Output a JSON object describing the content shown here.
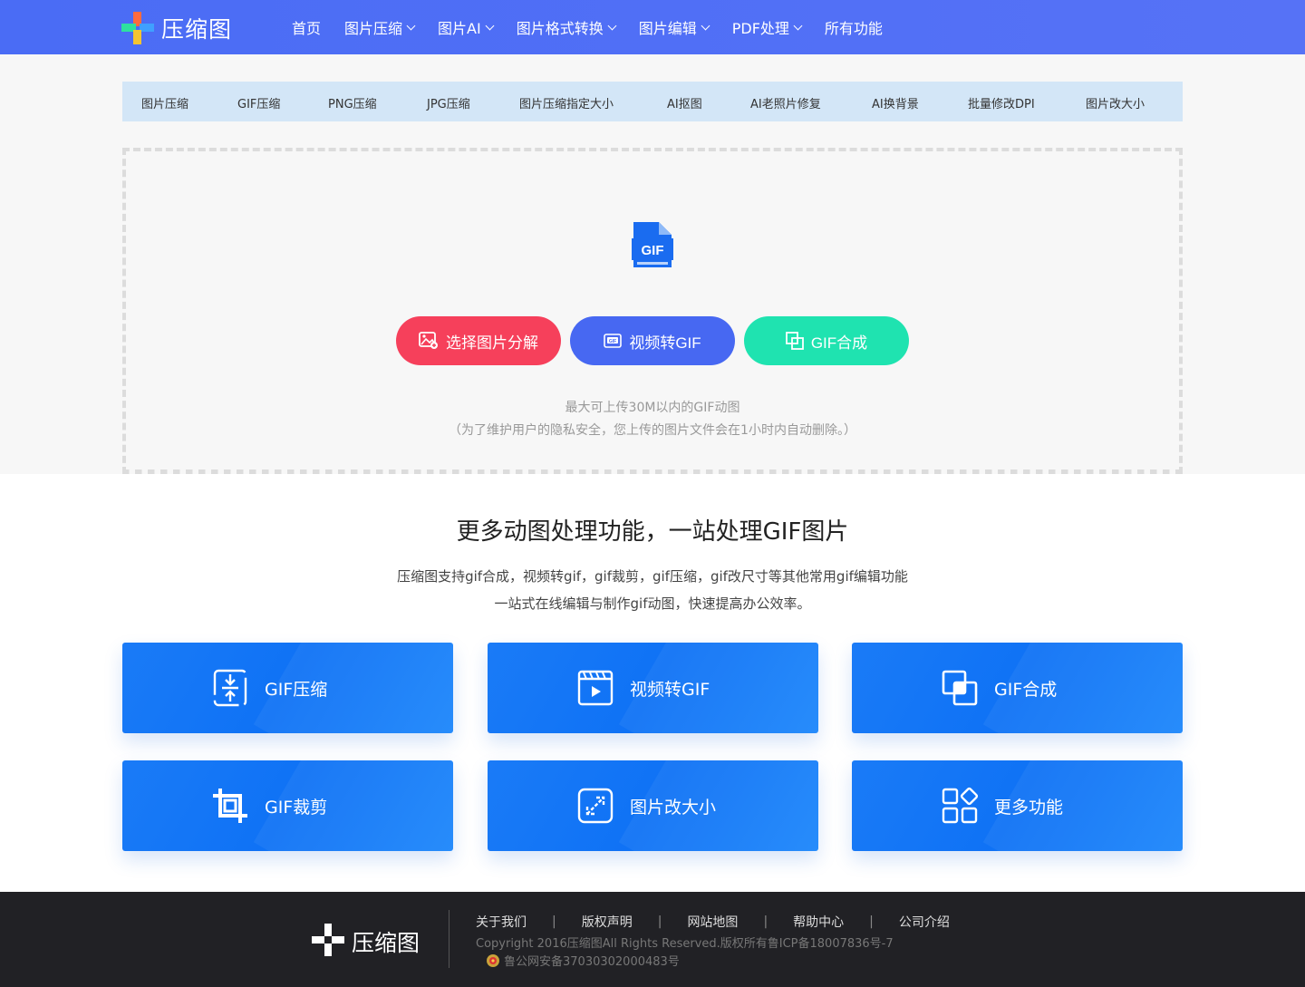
{
  "header": {
    "logo_text": "压缩图",
    "nav": [
      {
        "label": "首页",
        "has_dropdown": false
      },
      {
        "label": "图片压缩",
        "has_dropdown": true
      },
      {
        "label": "图片AI",
        "has_dropdown": true
      },
      {
        "label": "图片格式转换",
        "has_dropdown": true
      },
      {
        "label": "图片编辑",
        "has_dropdown": true
      },
      {
        "label": "PDF处理",
        "has_dropdown": true
      },
      {
        "label": "所有功能",
        "has_dropdown": false
      }
    ]
  },
  "subnav": [
    "图片压缩",
    "GIF压缩",
    "PNG压缩",
    "JPG压缩",
    "图片压缩指定大小",
    "AI抠图",
    "AI老照片修复",
    "AI换背景",
    "批量修改DPI",
    "图片改大小"
  ],
  "upload": {
    "file_icon_label": "GIF",
    "buttons": {
      "split": "选择图片分解",
      "video": "视频转GIF",
      "merge": "GIF合成"
    },
    "hint_limit": "最大可上传30M以内的GIF动图",
    "hint_privacy": "（为了维护用户的隐私安全，您上传的图片文件会在1小时内自动删除。）"
  },
  "features": {
    "title": "更多动图处理功能，一站处理GIF图片",
    "desc_line1": "压缩图支持gif合成，视频转gif，gif裁剪，gif压缩，gif改尺寸等其他常用gif编辑功能",
    "desc_line2": "一站式在线编辑与制作gif动图，快速提高办公效率。",
    "cards": [
      {
        "label": "GIF压缩",
        "icon": "compress-icon"
      },
      {
        "label": "视频转GIF",
        "icon": "video-icon"
      },
      {
        "label": "GIF合成",
        "icon": "merge-icon"
      },
      {
        "label": "GIF裁剪",
        "icon": "crop-icon"
      },
      {
        "label": "图片改大小",
        "icon": "resize-icon"
      },
      {
        "label": "更多功能",
        "icon": "more-apps-icon"
      }
    ]
  },
  "footer": {
    "logo_text": "压缩图",
    "links": [
      "关于我们",
      "版权声明",
      "网站地图",
      "帮助中心",
      "公司介绍"
    ],
    "copyright": "Copyright 2016压缩图All Rights Reserved.版权所有鲁ICP备18007836号-7",
    "police": "鲁公网安备37030302000483号"
  },
  "colors": {
    "header_bg": "#4e6ef2",
    "btn_red": "#f6405b",
    "btn_blue": "#4768f2",
    "btn_green": "#1fe3b0",
    "card_blue": "#1178f6",
    "footer_bg": "#212125"
  }
}
